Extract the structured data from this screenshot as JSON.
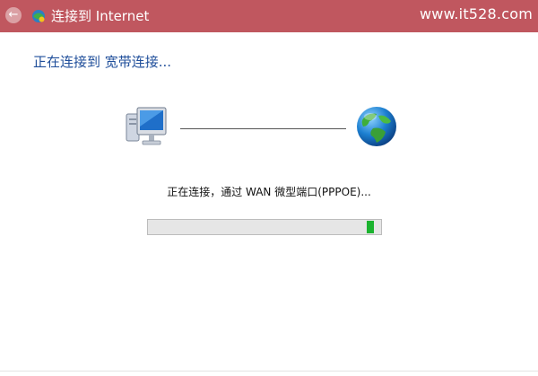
{
  "window": {
    "title": "连接到 Internet",
    "back_icon": "back-arrow-icon",
    "title_icon": "network-connection-icon"
  },
  "watermark": "www.it528.com",
  "main": {
    "heading": "正在连接到 宽带连接...",
    "left_icon": "computer-icon",
    "right_icon": "globe-icon",
    "status_text": "正在连接，通过 WAN 微型端口(PPPOE)...",
    "progress": {
      "value_fraction": 0.97,
      "state": "indeterminate-marquee"
    }
  },
  "colors": {
    "titlebar": "#c0575f",
    "heading": "#1f4e9a",
    "progress_fill": "#1bb32f",
    "background": "#ffffff"
  }
}
